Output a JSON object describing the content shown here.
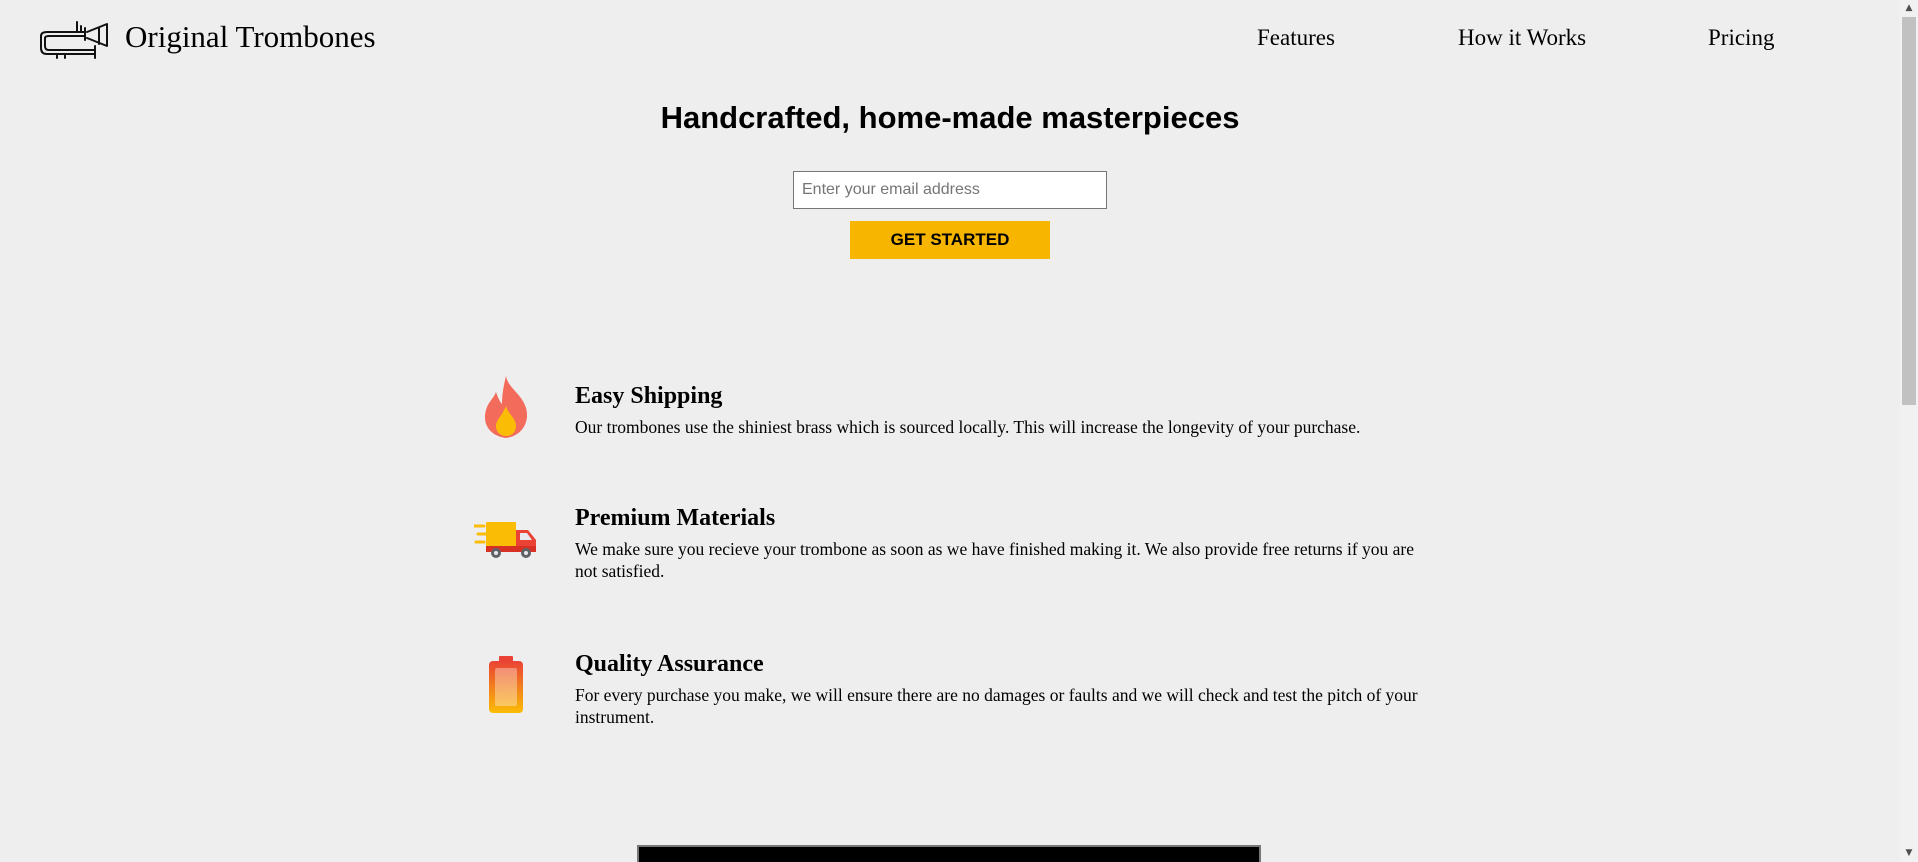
{
  "header": {
    "brand": "Original Trombones",
    "logo_icon": "trombone-icon",
    "nav": {
      "features": "Features",
      "how_it_works": "How it Works",
      "pricing": "Pricing"
    }
  },
  "hero": {
    "title": "Handcrafted, home-made masterpieces",
    "email_placeholder": "Enter your email address",
    "email_value": "",
    "cta_label": "Get Started"
  },
  "features": [
    {
      "icon": "fire-icon",
      "title": "Easy Shipping",
      "description": "Our trombones use the shiniest brass which is sourced locally. This will increase the longevity of your purchase."
    },
    {
      "icon": "delivery-truck-icon",
      "title": "Premium Materials",
      "description": "We make sure you recieve your trombone as soon as we have finished making it. We also provide free returns if you are not satisfied."
    },
    {
      "icon": "battery-icon",
      "title": "Quality Assurance",
      "description": "For every purchase you make, we will ensure there are no damages or faults and we will check and test the pitch of your instrument."
    }
  ],
  "colors": {
    "background": "#eeeeee",
    "cta": "#f7b500",
    "fire": "#f26b5b",
    "truck_cargo": "#fbbc05",
    "truck_cab": "#ea4335"
  }
}
